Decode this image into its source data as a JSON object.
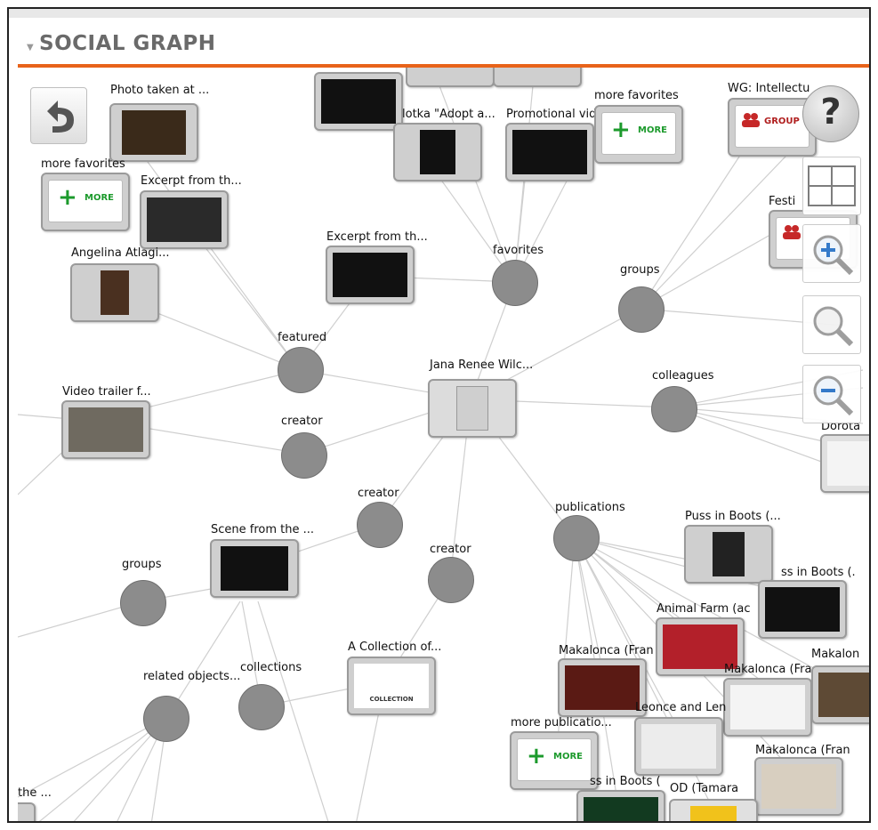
{
  "panel": {
    "title": "SOCIAL GRAPH"
  },
  "controls": {
    "help": "?"
  },
  "hubs": {
    "featured": "featured",
    "favorites": "favorites",
    "groups_top": "groups",
    "colleagues": "colleagues",
    "creator_left": "creator",
    "creator_mid": "creator",
    "creator_low": "creator",
    "publications": "publications",
    "groups_left": "groups",
    "related_objects": "related objects...",
    "collections": "collections"
  },
  "nodes": {
    "center": "Jana Renee Wilc...",
    "photo_taken": "Photo taken at ...",
    "more_fav_left": "more favorites",
    "more_fav_top": "more favorites",
    "excerpt_left": "Excerpt from th...",
    "angelina": "Angelina Atlagi...",
    "excerpt_mid": "Excerpt from th...",
    "lotka": "lotka \"Adopt a...",
    "promo": "Promotional vid...",
    "wg": "WG: Intellectu",
    "festi": "Festi",
    "video_trailer": "Video trailer f...",
    "dorota": "Dorota",
    "scene": "Scene from the ...",
    "collection": "A Collection of...",
    "puss1": "Puss in Boots (...",
    "puss2": "ss in Boots (.",
    "animal_farm": "Animal Farm (ac",
    "makalonca1": "Makalonca (Fran",
    "makalonca2": "Makalonca (Fra",
    "makalonca3": "Makalon",
    "makalonca4": "Makalonca (Fran",
    "leonce": "Leonce and Len",
    "more_pub": "more publicatio...",
    "puss3": "ss in Boots (",
    "od_tamara": "OD (Tamara",
    "the": "the ..."
  },
  "badges": {
    "more_text": "MORE",
    "group_text": "GROUP",
    "collection_text": "COLLECTION"
  }
}
